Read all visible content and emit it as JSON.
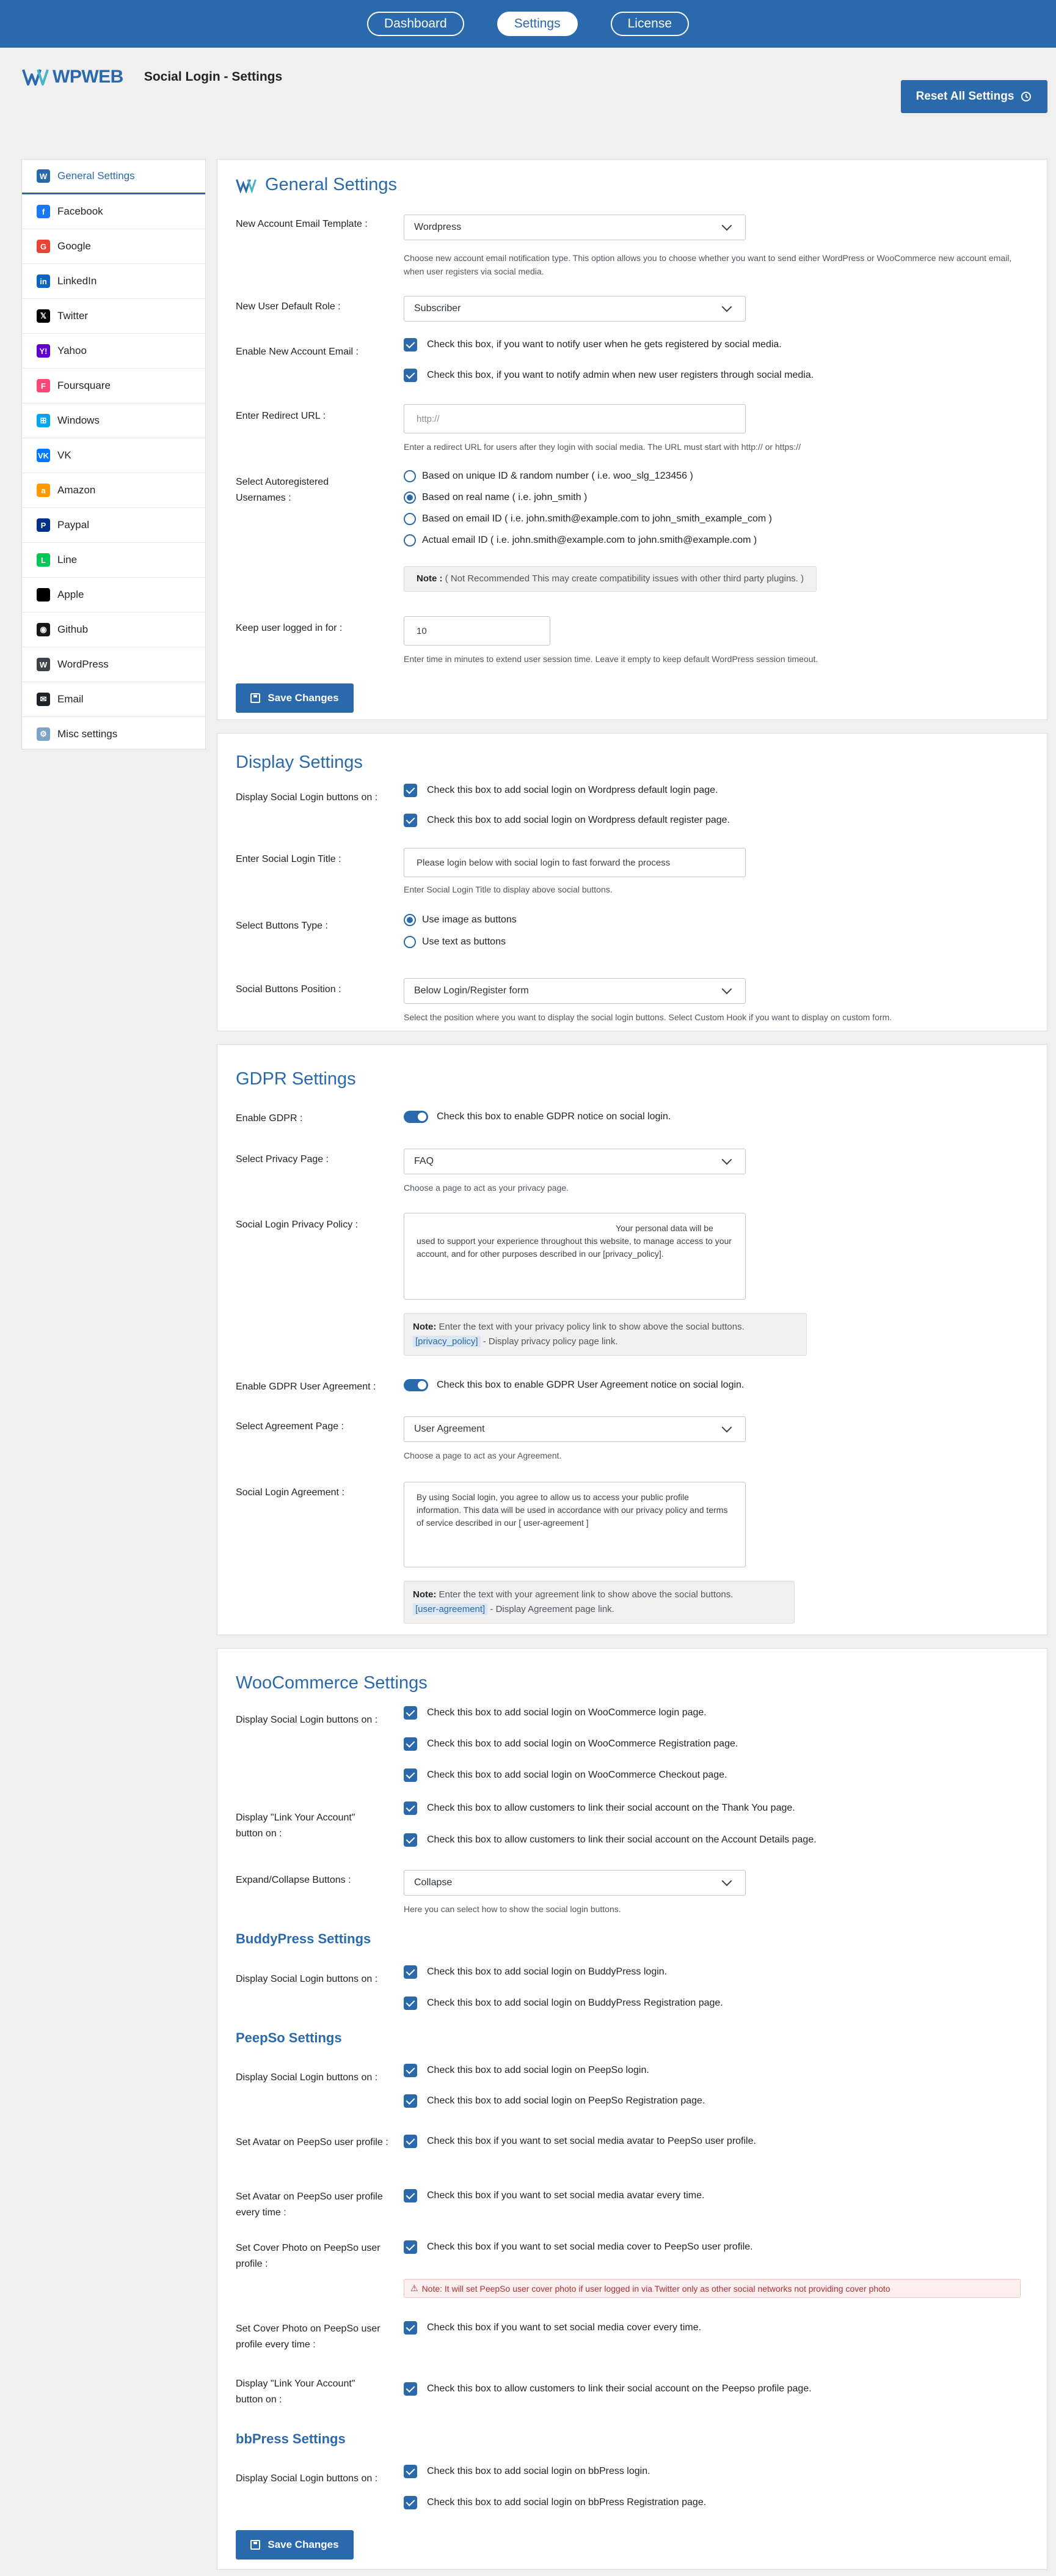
{
  "topnav": {
    "tabs": [
      "Dashboard",
      "Settings",
      "License"
    ]
  },
  "brand": {
    "logo_text": "WPWEB",
    "title": "Social Login - Settings"
  },
  "reset_label": "Reset All Settings",
  "sidebar": {
    "items": [
      {
        "label": "General Settings",
        "icon": "wpweb-icon",
        "color": "#2a69ac"
      },
      {
        "label": "Facebook",
        "icon": "facebook-icon",
        "color": "#1877f2"
      },
      {
        "label": "Google",
        "icon": "google-icon",
        "color": "#ea4335"
      },
      {
        "label": "LinkedIn",
        "icon": "linkedin-icon",
        "color": "#0a66c2"
      },
      {
        "label": "Twitter",
        "icon": "twitter-x-icon",
        "color": "#000000"
      },
      {
        "label": "Yahoo",
        "icon": "yahoo-icon",
        "color": "#6001d2"
      },
      {
        "label": "Foursquare",
        "icon": "foursquare-icon",
        "color": "#f94877"
      },
      {
        "label": "Windows",
        "icon": "windows-icon",
        "color": "#00a4ef"
      },
      {
        "label": "VK",
        "icon": "vk-icon",
        "color": "#0077ff"
      },
      {
        "label": "Amazon",
        "icon": "amazon-icon",
        "color": "#ff9900"
      },
      {
        "label": "Paypal",
        "icon": "paypal-icon",
        "color": "#003087"
      },
      {
        "label": "Line",
        "icon": "line-icon",
        "color": "#06c755"
      },
      {
        "label": "Apple",
        "icon": "apple-icon",
        "color": "#000000"
      },
      {
        "label": "Github",
        "icon": "github-icon",
        "color": "#181717"
      },
      {
        "label": "WordPress",
        "icon": "wordpress-icon",
        "color": "#3c434a"
      },
      {
        "label": "Email",
        "icon": "email-icon",
        "color": "#1d2327"
      },
      {
        "label": "Misc settings",
        "icon": "misc-gear-icon",
        "color": "#7ea3c9"
      }
    ]
  },
  "general": {
    "title": "General Settings",
    "email_template": {
      "label": "New Account Email Template :",
      "value": "Wordpress",
      "desc": "Choose new account email notification type. This option allows you to choose whether you want to send either WordPress or WooCommerce new account email, when user registers via social media."
    },
    "default_role": {
      "label": "New User Default Role :",
      "value": "Subscriber"
    },
    "enable_email": {
      "label": "Enable New Account Email :",
      "opt1": "Check this box, if you want to notify user when he gets registered by social media.",
      "opt2": "Check this box, if you want to notify admin when new user registers through social media."
    },
    "redirect": {
      "label": "Enter Redirect URL :",
      "placeholder": "http://",
      "desc": "Enter a redirect URL for users after they login with social media. The URL must start with http:// or https://"
    },
    "usernames": {
      "label": "Select Autoregistered Usernames :",
      "opts": [
        "Based on unique ID & random number ( i.e. woo_slg_123456 )",
        "Based on real name ( i.e. john_smith )",
        "Based on email ID ( i.e. john.smith@example.com to john_smith_example_com )",
        "Actual email ID ( i.e. john.smith@example.com to john.smith@example.com )"
      ],
      "note_label": "Note :",
      "note": "( Not Recommended This may create compatibility issues with other third party plugins. )"
    },
    "keep_logged": {
      "label": "Keep user logged in for :",
      "value": "10",
      "desc": "Enter time in minutes to extend user session time. Leave it empty to keep default WordPress session timeout."
    },
    "save": "Save Changes"
  },
  "display": {
    "title": "Display Settings",
    "buttons_on": {
      "label": "Display Social Login buttons on :",
      "opt1": "Check this box to add social login on Wordpress default login page.",
      "opt2": "Check this box to add social login on Wordpress default register page."
    },
    "login_title": {
      "label": "Enter Social Login Title :",
      "value": "Please login below with social login to fast forward the process",
      "desc": "Enter Social Login Title to display above social buttons."
    },
    "btn_type": {
      "label": "Select Buttons Type :",
      "opt1": "Use image as buttons",
      "opt2": "Use text as buttons"
    },
    "position": {
      "label": "Social Buttons Position :",
      "value": "Below Login/Register form",
      "desc": "Select the position where you want to display the social login buttons. Select Custom Hook if you want to display on custom form."
    }
  },
  "gdpr": {
    "title": "GDPR Settings",
    "enable": {
      "label": "Enable GDPR :",
      "text": "Check this box to enable GDPR notice on social login."
    },
    "privacy_page": {
      "label": "Select Privacy Page :",
      "value": "FAQ",
      "desc": "Choose a page to act as your privacy page."
    },
    "policy": {
      "label": "Social Login Privacy Policy :",
      "value": "Your personal data will be used to support your experience throughout this website, to manage access to your account, and for other purposes described in our [privacy_policy].",
      "note_label": "Note:",
      "note": "Enter the text with your privacy policy link to show above the social buttons.",
      "code": "[privacy_policy]",
      "code_desc": "- Display privacy policy page link."
    },
    "agreement_enable": {
      "label": "Enable GDPR User Agreement :",
      "text": "Check this box to enable GDPR User Agreement notice on social login."
    },
    "agreement_page": {
      "label": "Select Agreement Page :",
      "value": "User Agreement",
      "desc": "Choose a page to act as your Agreement."
    },
    "agreement": {
      "label": "Social Login Agreement :",
      "value": "By using Social login, you agree to allow us to access your public profile information. This data will be used in accordance with our privacy policy and terms of service described in our [ user-agreement ]",
      "note_label": "Note:",
      "note": "Enter the text with your agreement link to show above the social buttons.",
      "code": "[user-agreement]",
      "code_desc": "- Display Agreement page link."
    }
  },
  "woo": {
    "title": "WooCommerce Settings",
    "buttons_on": {
      "label": "Display Social Login buttons on :",
      "opts": [
        "Check this box to add social login on WooCommerce login page.",
        "Check this box to add social login on WooCommerce Registration page.",
        "Check this box to add social login on WooCommerce Checkout page."
      ]
    },
    "link_account": {
      "label": "Display \"Link Your Account\" button on :",
      "opts": [
        "Check this box to allow customers to link their social account on the Thank You page.",
        "Check this box to allow customers to link their social account on the Account Details page."
      ]
    },
    "expand": {
      "label": "Expand/Collapse Buttons :",
      "value": "Collapse",
      "desc": "Here you can select how to show the social login buttons."
    }
  },
  "buddypress": {
    "title": "BuddyPress Settings",
    "label": "Display Social Login buttons on :",
    "opts": [
      "Check this box to add social login on BuddyPress login.",
      "Check this box to add social login on BuddyPress Registration page."
    ]
  },
  "peepso": {
    "title": "PeepSo Settings",
    "buttons_on": {
      "label": "Display Social Login buttons on :",
      "opts": [
        "Check this box to add social login on PeepSo login.",
        "Check this box to add social login on PeepSo Registration page."
      ]
    },
    "avatar": {
      "label": "Set Avatar on PeepSo user profile :",
      "text": "Check this box if you want to set social media avatar to PeepSo user profile."
    },
    "avatar_every": {
      "label": "Set Avatar on PeepSo user profile every time :",
      "text": "Check this box if you want to set social media avatar every time."
    },
    "cover": {
      "label": "Set Cover Photo on PeepSo user profile :",
      "text": "Check this box if you want to set social media cover to PeepSo user profile.",
      "warn": "Note: It will set PeepSo user cover photo if user logged in via Twitter only as other social networks not providing cover photo"
    },
    "cover_every": {
      "label": "Set Cover Photo on PeepSo user profile every time :",
      "text": "Check this box if you want to set social media cover every time."
    },
    "link": {
      "label": "Display \"Link Your Account\" button on :",
      "text": "Check this box to allow customers to link their social account on the Peepso profile page."
    }
  },
  "bbpress": {
    "title": "bbPress Settings",
    "label": "Display Social Login buttons on :",
    "opts": [
      "Check this box to add social login on bbPress login.",
      "Check this box to add social login on bbPress Registration page."
    ],
    "save": "Save Changes"
  }
}
